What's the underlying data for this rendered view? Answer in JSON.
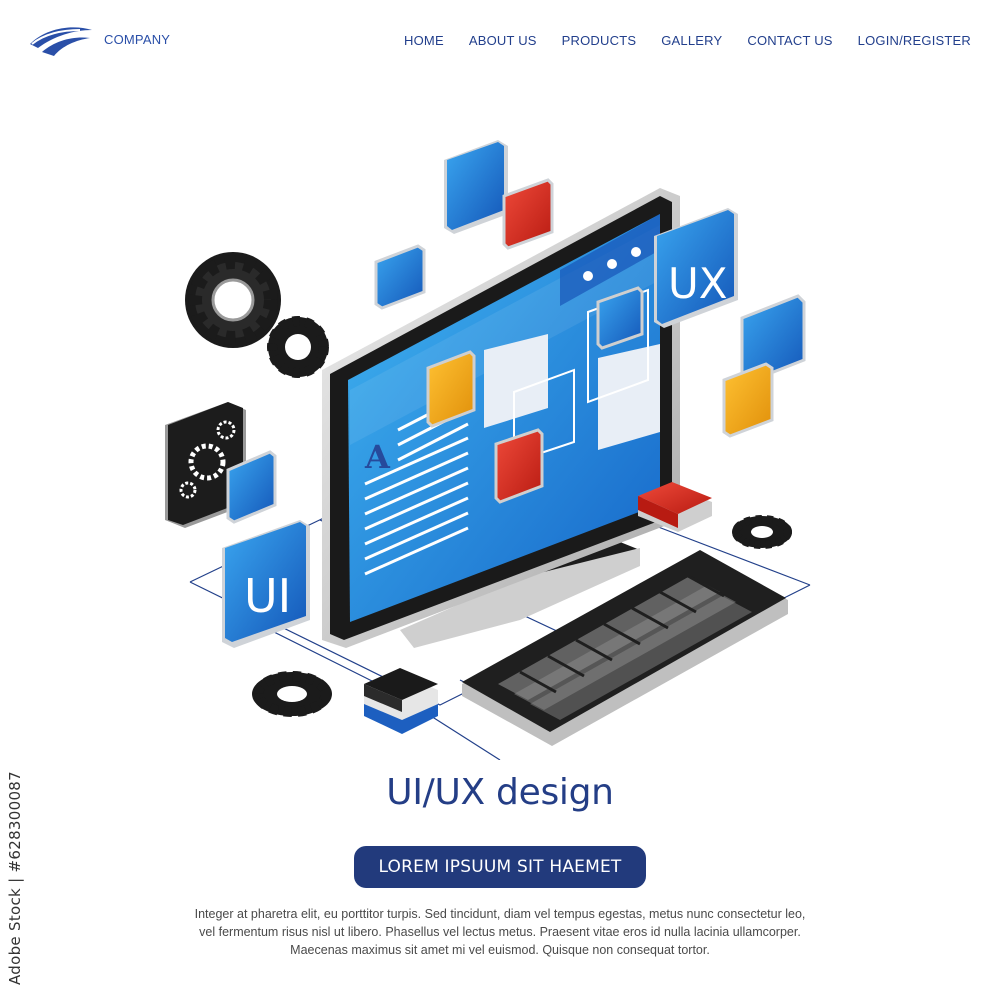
{
  "brand": {
    "name": "COMPANY"
  },
  "nav": {
    "items": [
      "HOME",
      "ABOUT US",
      "PRODUCTS",
      "GALLERY",
      "CONTACT US",
      "LOGIN/REGISTER"
    ]
  },
  "hero": {
    "monitor_letter": "A",
    "tile_ux": "UX",
    "tile_ui": "UI"
  },
  "headline": "UI/UX design",
  "cta": {
    "label": "LOREM IPSUUM SIT HAEMET"
  },
  "body": {
    "lines": [
      "Integer at pharetra elit, eu porttitor turpis. Sed tincidunt, diam vel tempus egestas, metus nunc consectetur leo,",
      "vel fermentum risus nisl ut libero. Phasellus vel lectus metus. Praesent vitae eros id nulla lacinia ullamcorper.",
      "Maecenas maximus sit amet mi vel euismod. Quisque non consequat tortor."
    ]
  },
  "stock_id": "Adobe Stock | #628300087",
  "colors": {
    "brand_blue": "#2a4fa8",
    "nav_blue": "#223f8c",
    "cta_bg": "#223a7c",
    "accent_red": "#d8281f",
    "accent_orange": "#f0a716",
    "screen_blue": "#1e7fd8"
  }
}
